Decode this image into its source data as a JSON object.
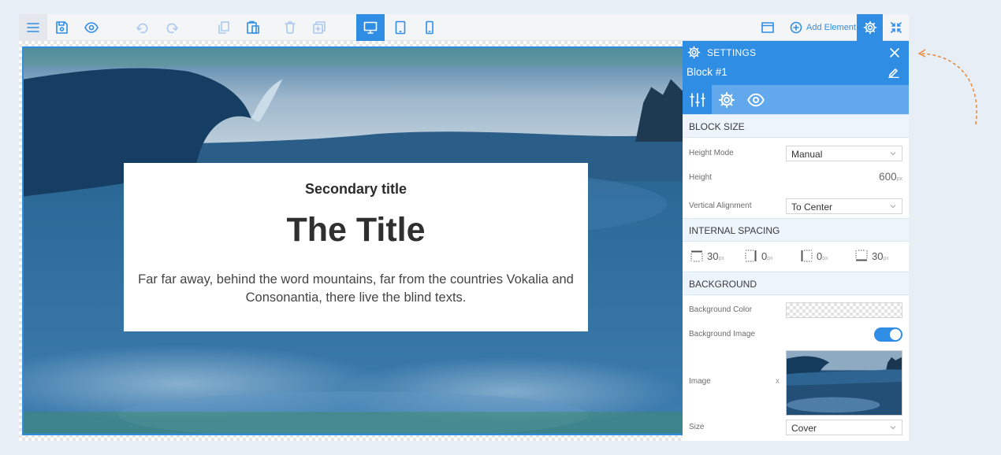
{
  "toolbar": {
    "add_element_label": "Add Element"
  },
  "canvas": {
    "secondary_title": "Secondary title",
    "title": "The Title",
    "body_text": "Far far away, behind the word mountains, far from the countries Vokalia and Consonantia, there live the blind texts."
  },
  "settings": {
    "header_title": "SETTINGS",
    "block_name": "Block #1",
    "block_size": {
      "heading": "BLOCK SIZE",
      "height_mode_label": "Height Mode",
      "height_mode_value": "Manual",
      "height_label": "Height",
      "height_value": "600",
      "height_unit": "px",
      "vertical_alignment_label": "Vertical Alignment",
      "vertical_alignment_value": "To Center"
    },
    "internal_spacing": {
      "heading": "INTERNAL SPACING",
      "unit": "px",
      "top": "30",
      "right": "0",
      "left": "0",
      "bottom": "30"
    },
    "background": {
      "heading": "BACKGROUND",
      "color_label": "Background Color",
      "image_label": "Background Image",
      "image_enabled": true,
      "image_field_label": "Image",
      "clear_label": "x",
      "size_label": "Size",
      "size_value": "Cover"
    }
  },
  "colors": {
    "accent": "#2f8de4",
    "accent_light": "#61a8ec",
    "section_bg": "#edf4fc",
    "page_bg": "#e8eef6",
    "arrow": "#e88a3a"
  }
}
